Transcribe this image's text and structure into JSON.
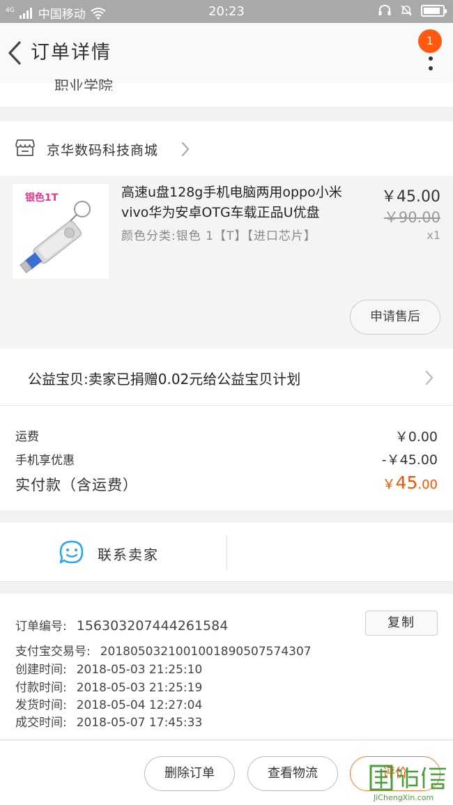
{
  "status_bar": {
    "network": "4G",
    "carrier": "中国移动",
    "time": "20:23",
    "battery_level_pct": 90
  },
  "header": {
    "title": "订单详情",
    "notification_count": "1"
  },
  "address_tail": "职业学院",
  "shop": {
    "name": "京华数码科技商城"
  },
  "product": {
    "thumb_tag": "银色1T",
    "title": "高速u盘128g手机电脑两用oppo小米vivo华为安卓OTG车载正品U优盘",
    "spec": "颜色分类:银色 1【T】【进口芯片】",
    "price": "￥45.00",
    "original_price": "￥90.00",
    "quantity": "x1",
    "after_sale_label": "申请售后"
  },
  "charity": {
    "text": "公益宝贝:卖家已捐赠0.02元给公益宝贝计划"
  },
  "fees": {
    "shipping_label": "运费",
    "shipping_value": "￥0.00",
    "discount_label": "手机享优惠",
    "discount_value": "-￥45.00",
    "total_label": "实付款（含运费）",
    "total_currency": "￥",
    "total_integer": "45",
    "total_decimal": ".00"
  },
  "contact": {
    "label": "联系卖家"
  },
  "order_info": {
    "order_no_label": "订单编号:",
    "order_no": "156303207444261584",
    "copy_label": "复制",
    "alipay_label": "支付宝交易号:",
    "alipay_no": "2018050321001001890507574307",
    "created_label": "创建时间:",
    "created": "2018-05-03 21:25:10",
    "paid_label": "付款时间:",
    "paid": "2018-05-03 21:25:19",
    "shipped_label": "发货时间:",
    "shipped": "2018-05-04 12:27:04",
    "completed_label": "成交时间:",
    "completed": "2018-05-07 17:45:33"
  },
  "actions": {
    "delete_label": "删除订单",
    "logistics_label": "查看物流",
    "review_label": "评价"
  },
  "watermark": {
    "glyphs": "集诚信",
    "sub": "JiChengXin.com"
  },
  "colors": {
    "accent": "#ff5000",
    "badge": "#ff5a10",
    "status_bar": "#a9a9a9",
    "contact_icon": "#2aa6f0"
  }
}
